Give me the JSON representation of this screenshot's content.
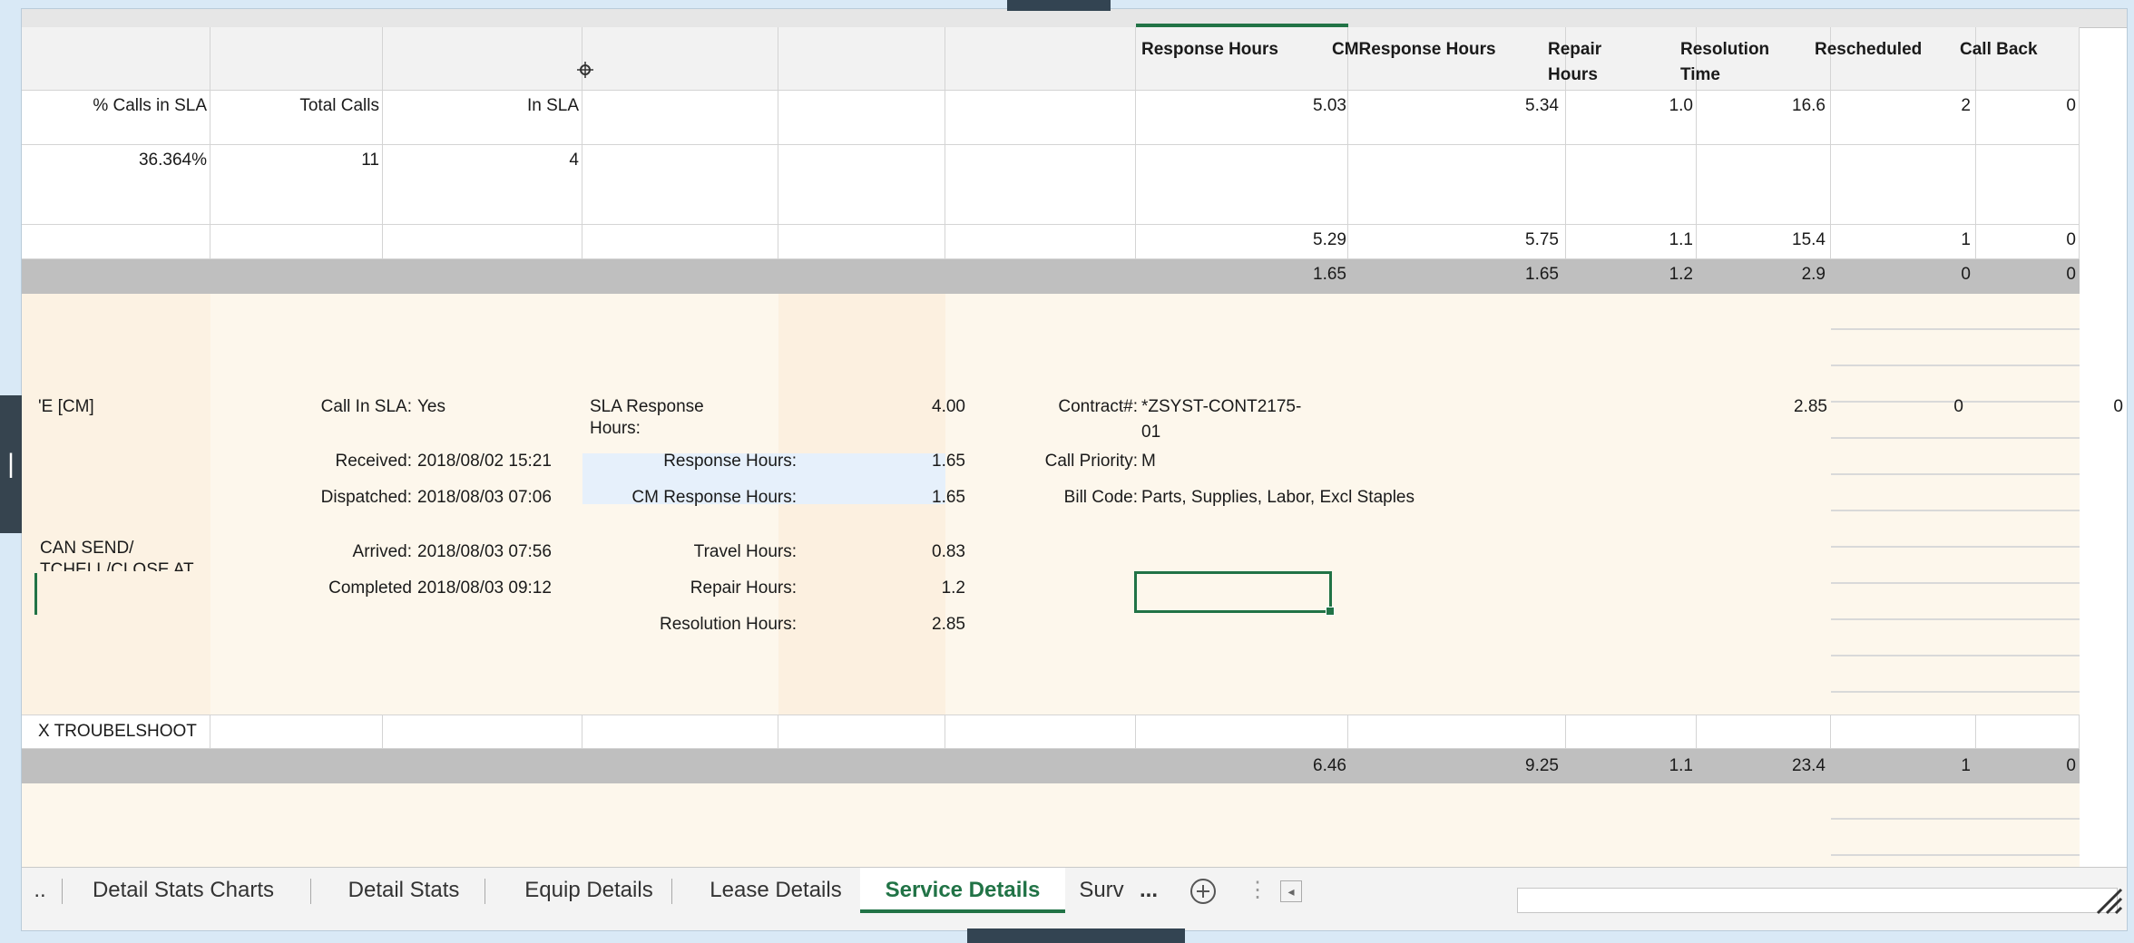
{
  "header": {
    "response_hours": "Response Hours",
    "cm_response_hours": "CMResponse Hours",
    "repair_hours_1": "Repair",
    "repair_hours_2": "Hours",
    "resolution_time_1": "Resolution",
    "resolution_time_2": "Time",
    "rescheduled": "Rescheduled",
    "call_back": "Call Back"
  },
  "summary_labels": {
    "pct_calls_in_sla": "% Calls in SLA",
    "total_calls": "Total Calls",
    "in_sla": "In SLA"
  },
  "summary_row1": {
    "response": "5.03",
    "cm_response": "5.34",
    "repair": "1.0",
    "resolution": "16.6",
    "rescheduled": "2",
    "call_back": "0"
  },
  "summary_values": {
    "pct": "36.364%",
    "total": "11",
    "in_sla": "4"
  },
  "summary_row2": {
    "response": "5.29",
    "cm_response": "5.75",
    "repair": "1.1",
    "resolution": "15.4",
    "rescheduled": "1",
    "call_back": "0"
  },
  "gray_row1": {
    "response": "1.65",
    "cm_response": "1.65",
    "repair": "1.2",
    "resolution": "2.9",
    "rescheduled": "0",
    "call_back": "0"
  },
  "detail": {
    "type_partial": "'E [CM]",
    "call_in_sla_label": "Call In SLA:",
    "call_in_sla_value": "Yes",
    "sla_response_label_1": "SLA Response",
    "sla_response_label_2": "Hours:",
    "sla_response_value": "4.00",
    "contract_label": "Contract#:",
    "contract_value_1": "*ZSYST-CONT2175-",
    "contract_value_2": "01",
    "resolution_total": "2.85",
    "rescheduled": "0",
    "call_back": "0",
    "received_label": "Received:",
    "received_value": "2018/08/02 15:21",
    "response_hours_label": "Response Hours:",
    "response_hours_value": "1.65",
    "call_priority_label": "Call Priority:",
    "call_priority_value": "M",
    "dispatched_label": "Dispatched:",
    "dispatched_value": "2018/08/03 07:06",
    "cm_response_label": "CM Response Hours:",
    "cm_response_value": "1.65",
    "bill_code_label": "Bill Code:",
    "bill_code_value": "Parts, Supplies, Labor, Excl Staples",
    "note_1": "CAN SEND/",
    "note_2": "TCHELL/CLOSE AT",
    "arrived_label": "Arrived:",
    "arrived_value": "2018/08/03 07:56",
    "travel_hours_label": "Travel Hours:",
    "travel_hours_value": "0.83",
    "completed_label": "Completed",
    "completed_value": "2018/08/03 09:12",
    "repair_hours_label": "Repair Hours:",
    "repair_hours_value": "1.2",
    "resolution_hours_label": "Resolution Hours:",
    "resolution_hours_value": "2.85"
  },
  "troubleshoot": "X TROUBELSHOOT",
  "gray_row2": {
    "response": "6.46",
    "cm_response": "9.25",
    "repair": "1.1",
    "resolution": "23.4",
    "rescheduled": "1",
    "call_back": "0"
  },
  "tabs": {
    "more_left": "..",
    "items": [
      "Detail Stats Charts",
      "Detail Stats",
      "Equip Details",
      "Lease Details",
      "Service Details",
      "Surv"
    ],
    "more_right": "...",
    "add": "+",
    "menu": "⋮",
    "scroll_left": "◂"
  },
  "colors": {
    "accent": "#217346",
    "gray_row": "#bfbfbf",
    "peach": "#fdf7ec",
    "highlight": "#e6f0fb"
  }
}
